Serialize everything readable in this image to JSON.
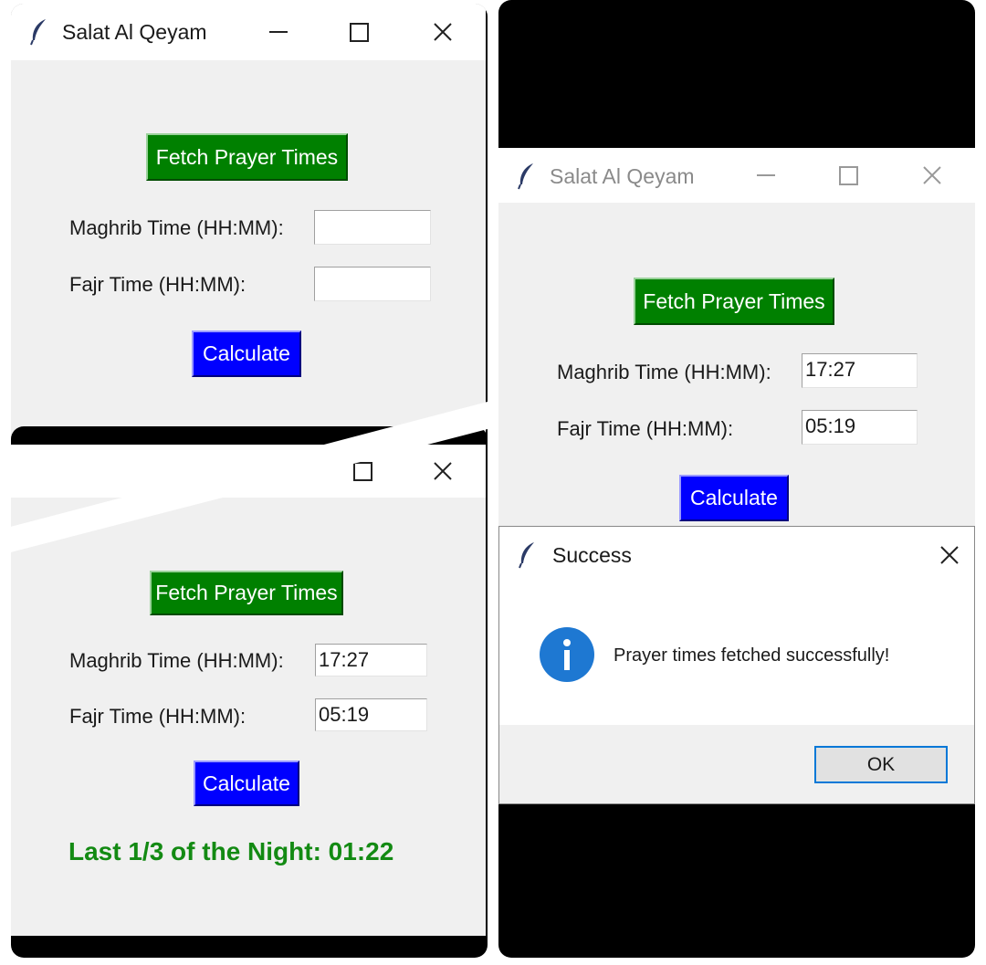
{
  "app": {
    "title": "Salat Al Qeyam",
    "fetch_label": "Fetch Prayer Times",
    "maghrib_label": "Maghrib Time (HH:MM):",
    "fajr_label": "Fajr Time (HH:MM):",
    "calculate_label": "Calculate"
  },
  "window_empty": {
    "maghrib_value": "",
    "fajr_value": ""
  },
  "window_result": {
    "maghrib_value": "17:27",
    "fajr_value": "05:19",
    "result_text": "Last 1/3 of the Night: 01:22"
  },
  "window_fetched": {
    "maghrib_value": "17:27",
    "fajr_value": "05:19"
  },
  "dialog": {
    "title": "Success",
    "message": "Prayer times fetched successfully!",
    "ok_label": "OK"
  },
  "colors": {
    "fetch_button": "#008000",
    "calculate_button": "#0000ff",
    "result_text": "#138a13",
    "info_icon": "#1e78d2"
  },
  "icons": [
    "feather-icon",
    "minimize-icon",
    "maximize-icon",
    "close-icon",
    "info-icon"
  ]
}
